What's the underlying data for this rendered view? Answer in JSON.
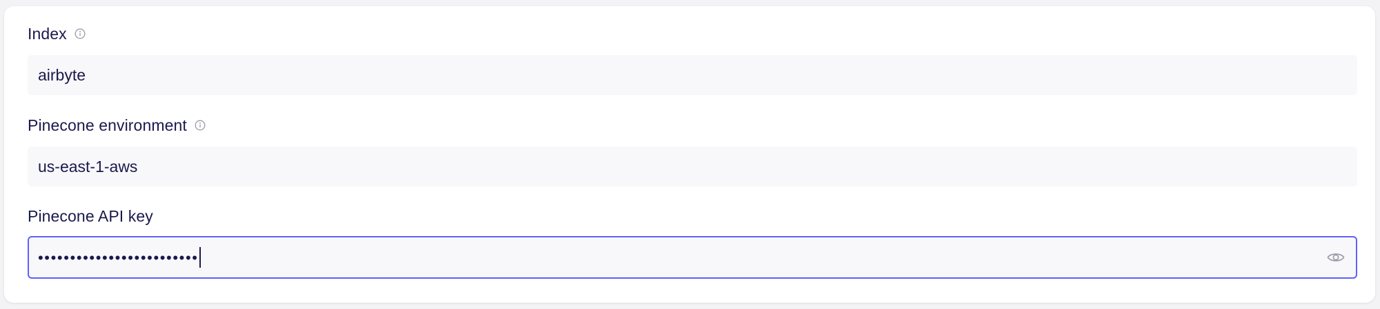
{
  "form": {
    "index": {
      "label": "Index",
      "info_icon": "info-circle-icon",
      "value": "airbyte"
    },
    "environment": {
      "label": "Pinecone environment",
      "info_icon": "info-circle-icon",
      "value": "us-east-1-aws"
    },
    "api_key": {
      "label": "Pinecone API key",
      "masked_value": "•••••••••••••••••••••••••",
      "toggle_icon": "eye-icon"
    }
  },
  "colors": {
    "text": "#1a194d",
    "input_bg": "#f8f8fa",
    "focus_border": "#615eff",
    "icon_gray": "#9a9aaa"
  }
}
